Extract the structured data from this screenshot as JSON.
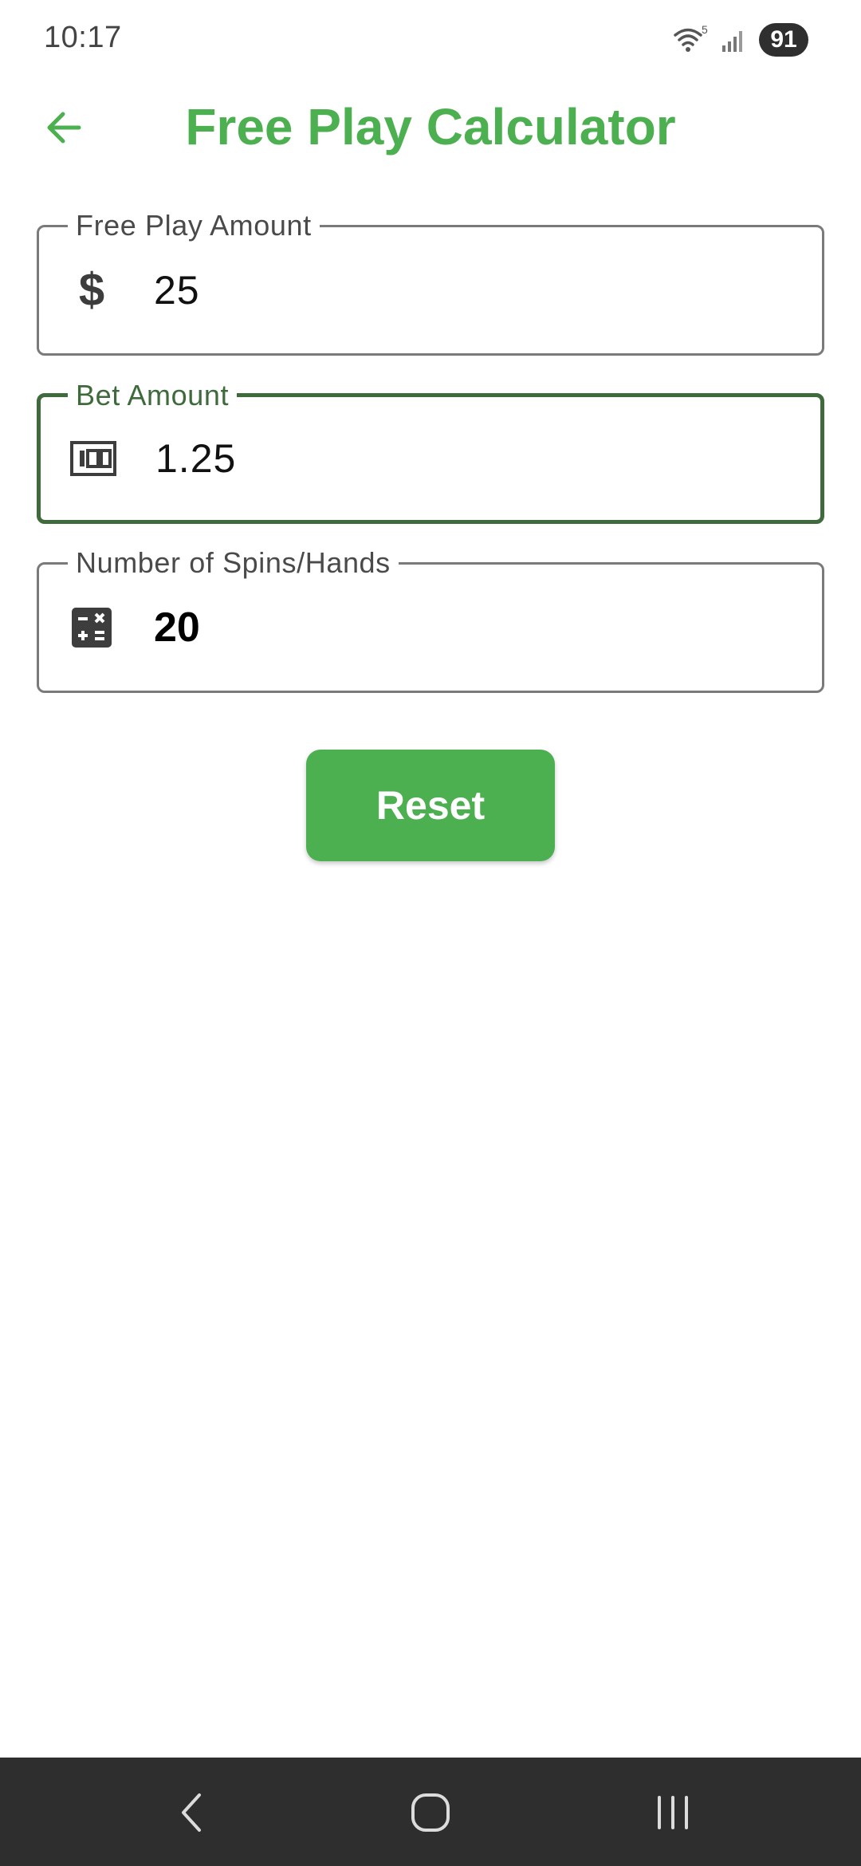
{
  "status_bar": {
    "time": "10:17",
    "wifi_badge": "5",
    "battery": "91"
  },
  "app_bar": {
    "title": "Free Play Calculator",
    "back_icon": "arrow-back-icon",
    "accent_color": "#4caf50"
  },
  "form": {
    "free_play": {
      "label": "Free Play Amount",
      "value": "25",
      "icon": "dollar-icon"
    },
    "bet": {
      "label": "Bet Amount",
      "value": "1.25",
      "icon": "money-icon",
      "focused_color": "#3f6a3c"
    },
    "spins": {
      "label": "Number of Spins/Hands",
      "value": "20",
      "icon": "calculator-icon"
    }
  },
  "reset_button": {
    "label": "Reset"
  },
  "nav_bar": {
    "back_icon": "nav-back-icon",
    "home_icon": "nav-home-icon",
    "recents_icon": "nav-recents-icon"
  }
}
